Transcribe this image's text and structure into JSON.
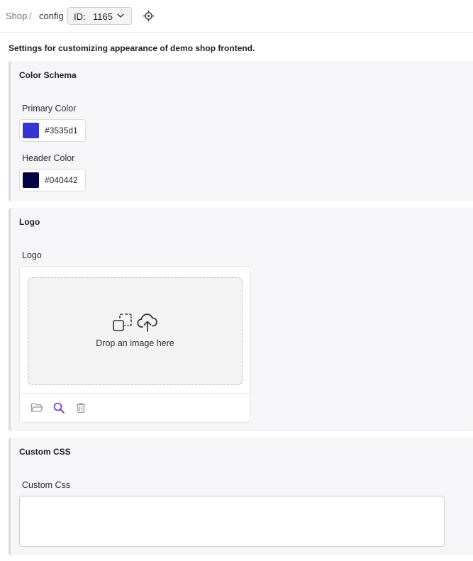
{
  "breadcrumb": {
    "shop": "Shop",
    "separator": "/",
    "config": "config"
  },
  "id_select": {
    "label": "ID:",
    "value": "1165"
  },
  "intro_text": "Settings for customizing appearance of demo shop frontend.",
  "color_schema": {
    "title": "Color Schema",
    "primary": {
      "label": "Primary Color",
      "value": "#3535d1"
    },
    "header": {
      "label": "Header Color",
      "value": "#040442"
    }
  },
  "logo": {
    "title": "Logo",
    "label": "Logo",
    "drop_text": "Drop an image here",
    "icons": [
      "select-image-icon",
      "upload-cloud-icon",
      "folder-open-icon",
      "search-icon",
      "trash-icon"
    ]
  },
  "custom_css": {
    "title": "Custom CSS",
    "label": "Custom Css",
    "value": ""
  },
  "colors": {
    "accent": "#6b2fb8",
    "section_bg": "#f6f6f8",
    "icon_muted": "#9a9aa2"
  }
}
